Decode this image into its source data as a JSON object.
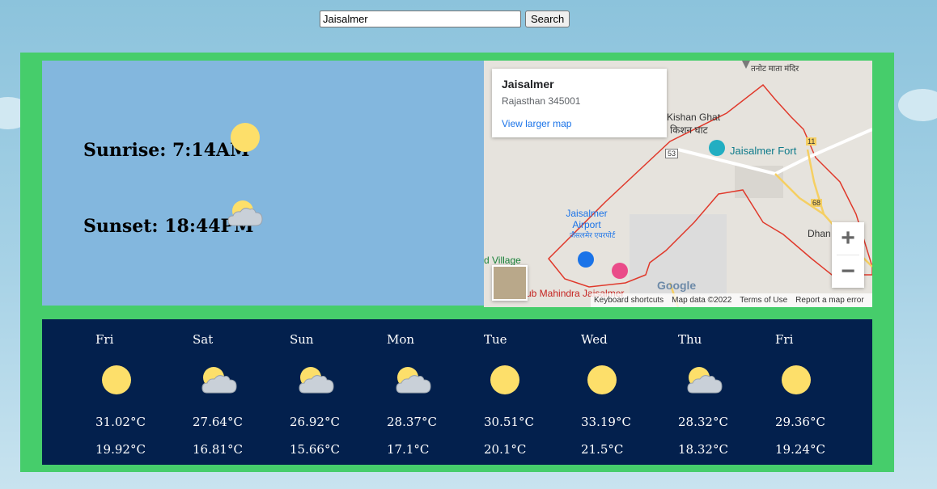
{
  "search": {
    "value": "Jaisalmer",
    "button_label": "Search"
  },
  "sun": {
    "sunrise_label": "Sunrise: 7:14AM",
    "sunset_label": "Sunset: 18:44PM",
    "sunrise_icon": "sun-icon",
    "sunset_icon": "partly-cloudy-icon"
  },
  "map": {
    "place_title": "Jaisalmer",
    "place_address": "Rajasthan 345001",
    "larger_map_link": "View larger map",
    "labels": {
      "fort": "Jaisalmer Fort",
      "kishan_ghat": "Kishan Ghat",
      "kishan_ghat_hi": "किशन घाट",
      "airport": "Jaisalmer Airport",
      "airport_hi": "जैसलमेर एयरपोर्ट",
      "temple": "तनोट माता मंदिर",
      "village": "d Village",
      "club": "ub Mahindra Jaisalmer",
      "dhan": "Dhan",
      "road_53": "53",
      "road_11": "11",
      "road_68": "68"
    },
    "footer": {
      "shortcuts": "Keyboard shortcuts",
      "data": "Map data ©2022",
      "terms": "Terms of Use",
      "report": "Report a map error"
    },
    "google_logo": "Google",
    "zoom_in": "+",
    "zoom_out": "−"
  },
  "forecast": [
    {
      "day": "Fri",
      "icon": "sun-icon",
      "max": "31.02°C",
      "min": "19.92°C"
    },
    {
      "day": "Sat",
      "icon": "partly-cloudy-icon",
      "max": "27.64°C",
      "min": "16.81°C"
    },
    {
      "day": "Sun",
      "icon": "partly-cloudy-icon",
      "max": "26.92°C",
      "min": "15.66°C"
    },
    {
      "day": "Mon",
      "icon": "partly-cloudy-icon",
      "max": "28.37°C",
      "min": "17.1°C"
    },
    {
      "day": "Tue",
      "icon": "sun-icon",
      "max": "30.51°C",
      "min": "20.1°C"
    },
    {
      "day": "Wed",
      "icon": "sun-icon",
      "max": "33.19°C",
      "min": "21.5°C"
    },
    {
      "day": "Thu",
      "icon": "partly-cloudy-icon",
      "max": "28.32°C",
      "min": "18.32°C"
    },
    {
      "day": "Fri",
      "icon": "sun-icon",
      "max": "29.36°C",
      "min": "19.24°C"
    }
  ],
  "colors": {
    "page_sky": "#8cc3dc",
    "outer_panel": "#46cd6b",
    "sun_panel": "#83b7de",
    "forecast_panel": "#03204d",
    "sun": "#fddf6a"
  }
}
